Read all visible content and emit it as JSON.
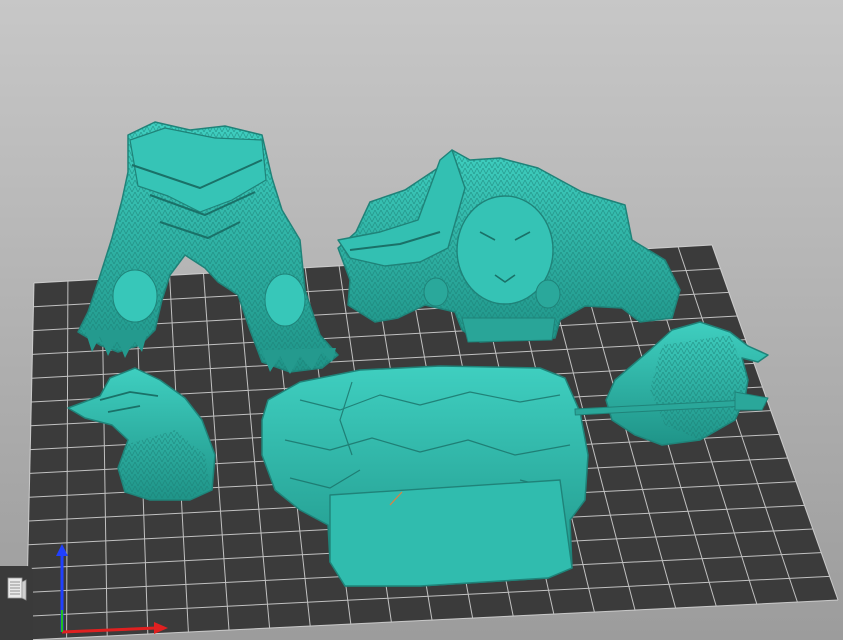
{
  "viewport": {
    "background_top": "#c7c7c7",
    "background_bottom": "#9c9c9c"
  },
  "bed": {
    "color": "#3b3b3b",
    "grid_color": "#d9d9d9",
    "grid_columns": 20,
    "grid_rows": 15
  },
  "model": {
    "color": "#2bb3a6",
    "shadow_color": "#1f8379",
    "highlight_color": "#45d2c4"
  },
  "parts": [
    "bear-legs-part",
    "bear-torso-part",
    "bear-arm-left-part",
    "base-rock-part",
    "bear-arm-right-part"
  ],
  "toolbar": {
    "layers_icon": "layers-icon"
  },
  "axes": {
    "x_color": "#e02020",
    "y_color": "#20c020",
    "z_color": "#2040ff"
  }
}
